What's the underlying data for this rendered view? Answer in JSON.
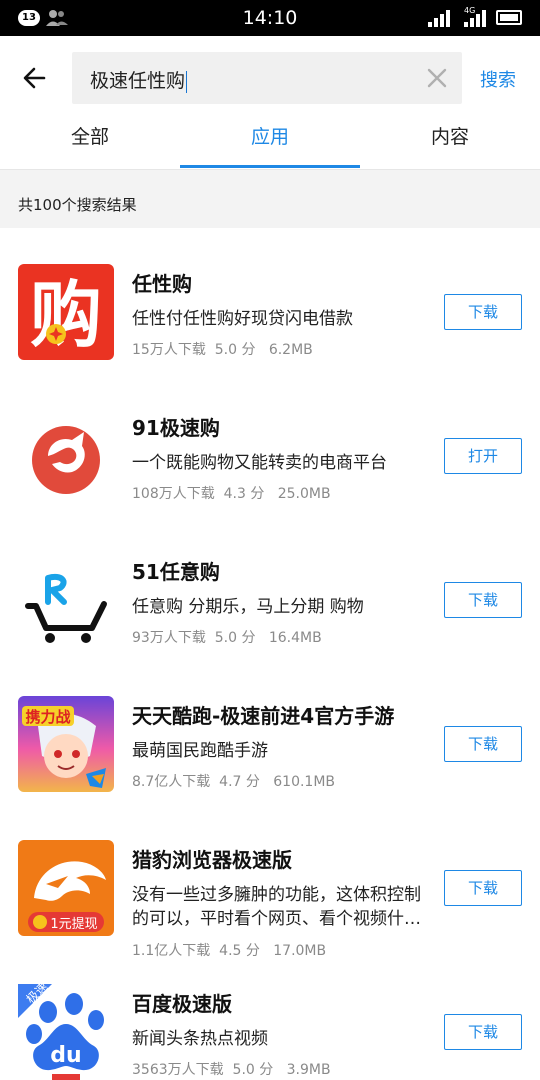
{
  "status_bar": {
    "notification_count": "13",
    "time": "14:10",
    "network": "4G"
  },
  "search": {
    "query": "极速任性购",
    "button_label": "搜索"
  },
  "tabs": [
    {
      "label": "全部",
      "active": false
    },
    {
      "label": "应用",
      "active": true
    },
    {
      "label": "内容",
      "active": false
    }
  ],
  "result_count": "共100个搜索结果",
  "apps": [
    {
      "name": "任性购",
      "desc": "任性付任性购好现贷闪电借款",
      "downloads": "15万人下载",
      "rating": "5.0 分",
      "size": "6.2MB",
      "button": "下载"
    },
    {
      "name": "91极速购",
      "desc": "一个既能购物又能转卖的电商平台",
      "downloads": "108万人下载",
      "rating": "4.3 分",
      "size": "25.0MB",
      "button": "打开"
    },
    {
      "name": "51任意购",
      "desc": "任意购 分期乐，马上分期 购物",
      "downloads": "93万人下载",
      "rating": "5.0 分",
      "size": "16.4MB",
      "button": "下载"
    },
    {
      "name": "天天酷跑-极速前进4官方手游",
      "desc": "最萌国民跑酷手游",
      "downloads": "8.7亿人下载",
      "rating": "4.7 分",
      "size": "610.1MB",
      "button": "下载"
    },
    {
      "name": "猎豹浏览器极速版",
      "desc": "没有一些过多臃肿的功能，这体积控制的可以，平时看个网页、看个视频什么的都很流畅",
      "downloads": "1.1亿人下载",
      "rating": "4.5 分",
      "size": "17.0MB",
      "button": "下载"
    },
    {
      "name": "百度极速版",
      "desc": "新闻头条热点视频",
      "downloads": "3563万人下载",
      "rating": "5.0 分",
      "size": "3.9MB",
      "button": "下载"
    }
  ],
  "icon_text": {
    "renxinggou_glyph": "购",
    "cheetah_promo": "1元提现",
    "baidu_badge": "极速",
    "baidu_logo": "du",
    "game_badge": "携力战"
  },
  "colors": {
    "accent": "#1e88e5",
    "renxinggou_red": "#ea3322",
    "sugou_red": "#e14a3b",
    "cheetah_orange": "#f07a16",
    "baidu_blue": "#2f6fe8"
  }
}
